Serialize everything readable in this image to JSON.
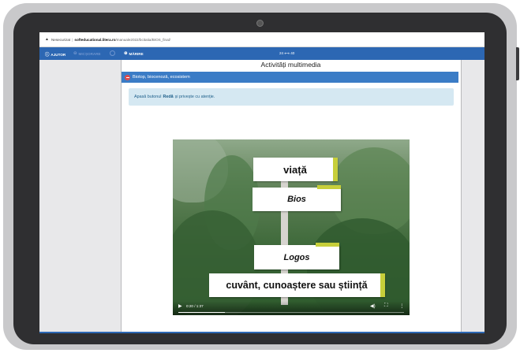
{
  "browser": {
    "security_label": "Nesecurizat",
    "url_host": "softeducational.litera.ro",
    "url_path": "/manuale2022/bcitatia/BIOS_final/"
  },
  "toolbar": {
    "help_label": "AJUTOR",
    "shrink_label": "MICȘORARE",
    "grow_label": "MĂRIRE",
    "pages_label": "24 ⟷ 40"
  },
  "page": {
    "title": "Activități multimedia",
    "section_title": "Biotop, biocenoză, ecosistem",
    "instruction_pre": "Apasă butonul",
    "instruction_bold": "Redă",
    "instruction_post": "și privește cu atenție."
  },
  "video": {
    "signs": [
      "viață",
      "Bios",
      "Logos",
      "cuvânt, cunoaștere sau știință"
    ],
    "time": "0:20 / 1:37",
    "progress": 0.2062
  },
  "colors": {
    "toolbar": "#2c67b3",
    "section_bar": "#3b7cc6",
    "info_box": "#d5e8f2",
    "sign_accent": "#c7cf3a"
  },
  "icons": [
    "warning-icon",
    "help-icon",
    "zoom-out-icon",
    "zoom-in-icon",
    "play-icon",
    "volume-icon",
    "fullscreen-icon",
    "more-options-icon"
  ]
}
